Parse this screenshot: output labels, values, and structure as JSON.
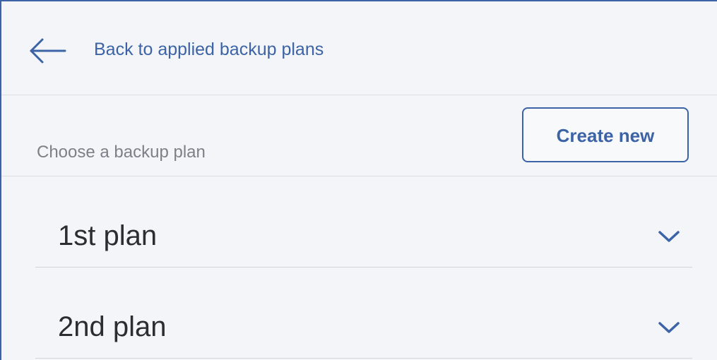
{
  "header": {
    "back_label": "Back to applied backup plans",
    "back_icon": "arrow-left-icon"
  },
  "toolbar": {
    "section_label": "Choose a backup plan",
    "create_label": "Create new"
  },
  "plans": [
    {
      "name": "1st plan",
      "icon": "chevron-down-icon"
    },
    {
      "name": "2nd plan",
      "icon": "chevron-down-icon"
    }
  ],
  "colors": {
    "accent": "#3b63a6",
    "background": "#f4f5f8",
    "muted_text": "#7d8088",
    "primary_text": "#2b2d33",
    "divider": "#dcdee3"
  }
}
